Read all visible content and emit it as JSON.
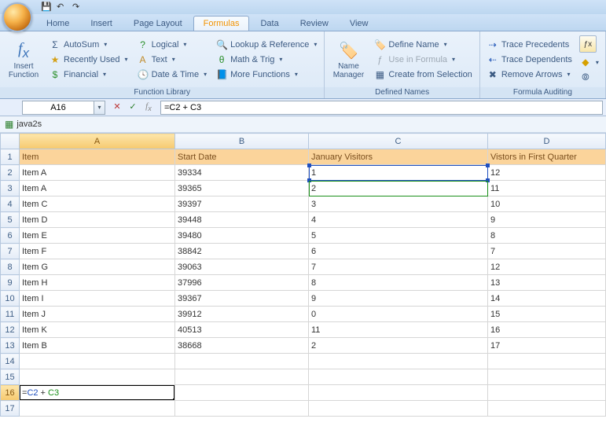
{
  "tabs": [
    "Home",
    "Insert",
    "Page Layout",
    "Formulas",
    "Data",
    "Review",
    "View"
  ],
  "active_tab": "Formulas",
  "ribbon": {
    "insert_fn": "Insert\nFunction",
    "lib": {
      "autosum": "AutoSum",
      "recent": "Recently Used",
      "financial": "Financial",
      "logical": "Logical",
      "text": "Text",
      "date": "Date & Time",
      "lookup": "Lookup & Reference",
      "math": "Math & Trig",
      "more": "More Functions",
      "title": "Function Library"
    },
    "names": {
      "manager": "Name\nManager",
      "define": "Define Name",
      "use": "Use in Formula",
      "create": "Create from Selection",
      "title": "Defined Names"
    },
    "audit": {
      "prec": "Trace Precedents",
      "dep": "Trace Dependents",
      "rem": "Remove Arrows",
      "title": "Formula Auditing"
    }
  },
  "namebox": "A16",
  "formula_display": "=C2 + C3",
  "workbook": "java2s",
  "columns": [
    "A",
    "B",
    "C",
    "D"
  ],
  "headers": {
    "A": "Item",
    "B": "Start Date",
    "C": "January Visitors",
    "D": "Vistors in First Quarter"
  },
  "chart_data": {
    "type": "table",
    "columns": [
      "Item",
      "Start Date",
      "January Visitors",
      "Vistors in First Quarter"
    ],
    "rows": [
      [
        "Item A",
        "39334",
        "1",
        "12"
      ],
      [
        "Item A",
        "39365",
        "2",
        "11"
      ],
      [
        "Item C",
        "39397",
        "3",
        "10"
      ],
      [
        "Item D",
        "39448",
        "4",
        "9"
      ],
      [
        "Item E",
        "39480",
        "5",
        "8"
      ],
      [
        "Item F",
        "38842",
        "6",
        "7"
      ],
      [
        "Item G",
        "39063",
        "7",
        "12"
      ],
      [
        "Item H",
        "37996",
        "8",
        "13"
      ],
      [
        "Item I",
        "39367",
        "9",
        "14"
      ],
      [
        "Item J",
        "39912",
        "0",
        "15"
      ],
      [
        "Item K",
        "40513",
        "11",
        "16"
      ],
      [
        "Item B",
        "38668",
        "2",
        "17"
      ]
    ]
  },
  "edit_cell": {
    "row": 16,
    "prefix": "=",
    "ref1": "C2",
    "mid": " + ",
    "ref2": "C3"
  }
}
